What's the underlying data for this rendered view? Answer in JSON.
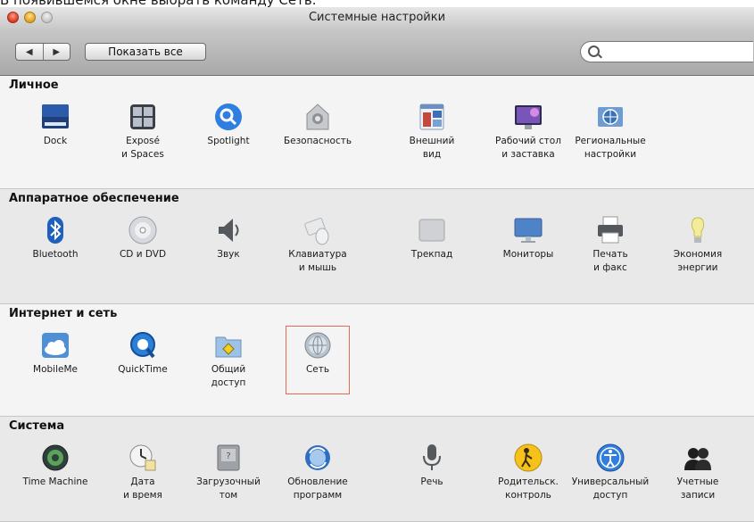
{
  "caption": "В появившемся окне выбрать команду Сеть.",
  "window": {
    "title": "Системные настройки",
    "nav_back_glyph": "◀",
    "nav_forward_glyph": "▶",
    "show_all_label": "Показать все",
    "search_value": ""
  },
  "sections": [
    {
      "title": "Личное",
      "items": [
        {
          "icon": "dock-icon",
          "label": "Dock"
        },
        {
          "icon": "expose-icon",
          "label": "Exposé\nи Spaces"
        },
        {
          "icon": "spotlight-icon",
          "label": "Spotlight"
        },
        {
          "icon": "security-icon",
          "label": "Безопасность"
        },
        {
          "icon": "appearance-icon",
          "label": "Внешний\nвид"
        },
        {
          "icon": "desktop-icon",
          "label": "Рабочий стол\nи заставка"
        },
        {
          "icon": "international-icon",
          "label": "Региональные\nнастройки"
        }
      ]
    },
    {
      "title": "Аппаратное обеспечение",
      "items": [
        {
          "icon": "bluetooth-icon",
          "label": "Bluetooth"
        },
        {
          "icon": "cd-dvd-icon",
          "label": "CD и DVD"
        },
        {
          "icon": "sound-icon",
          "label": "Звук"
        },
        {
          "icon": "keyboard-mouse-icon",
          "label": "Клавиатура\nи мышь"
        },
        {
          "icon": "trackpad-icon",
          "label": "Трекпад"
        },
        {
          "icon": "displays-icon",
          "label": "Мониторы"
        },
        {
          "icon": "printer-icon",
          "label": "Печать\nи факс"
        },
        {
          "icon": "energy-icon",
          "label": "Экономия\nэнергии"
        }
      ]
    },
    {
      "title": "Интернет и сеть",
      "items": [
        {
          "icon": "mobileme-icon",
          "label": "MobileMe"
        },
        {
          "icon": "quicktime-icon",
          "label": "QuickTime"
        },
        {
          "icon": "sharing-icon",
          "label": "Общий\nдоступ"
        },
        {
          "icon": "network-icon",
          "label": "Сеть",
          "selected": true
        }
      ]
    },
    {
      "title": "Система",
      "items": [
        {
          "icon": "time-machine-icon",
          "label": "Time Machine"
        },
        {
          "icon": "date-time-icon",
          "label": "Дата\nи время"
        },
        {
          "icon": "startup-disk-icon",
          "label": "Загрузочный\nтом"
        },
        {
          "icon": "software-update-icon",
          "label": "Обновление\nпрограмм"
        },
        {
          "icon": "speech-icon",
          "label": "Речь"
        },
        {
          "icon": "parental-controls-icon",
          "label": "Родительск.\nконтроль"
        },
        {
          "icon": "universal-access-icon",
          "label": "Универсальный\nдоступ"
        },
        {
          "icon": "accounts-icon",
          "label": "Учетные\nзаписи"
        }
      ]
    }
  ],
  "colors": {
    "selection_border": "#e06b50",
    "window_bg": "#ececec"
  }
}
